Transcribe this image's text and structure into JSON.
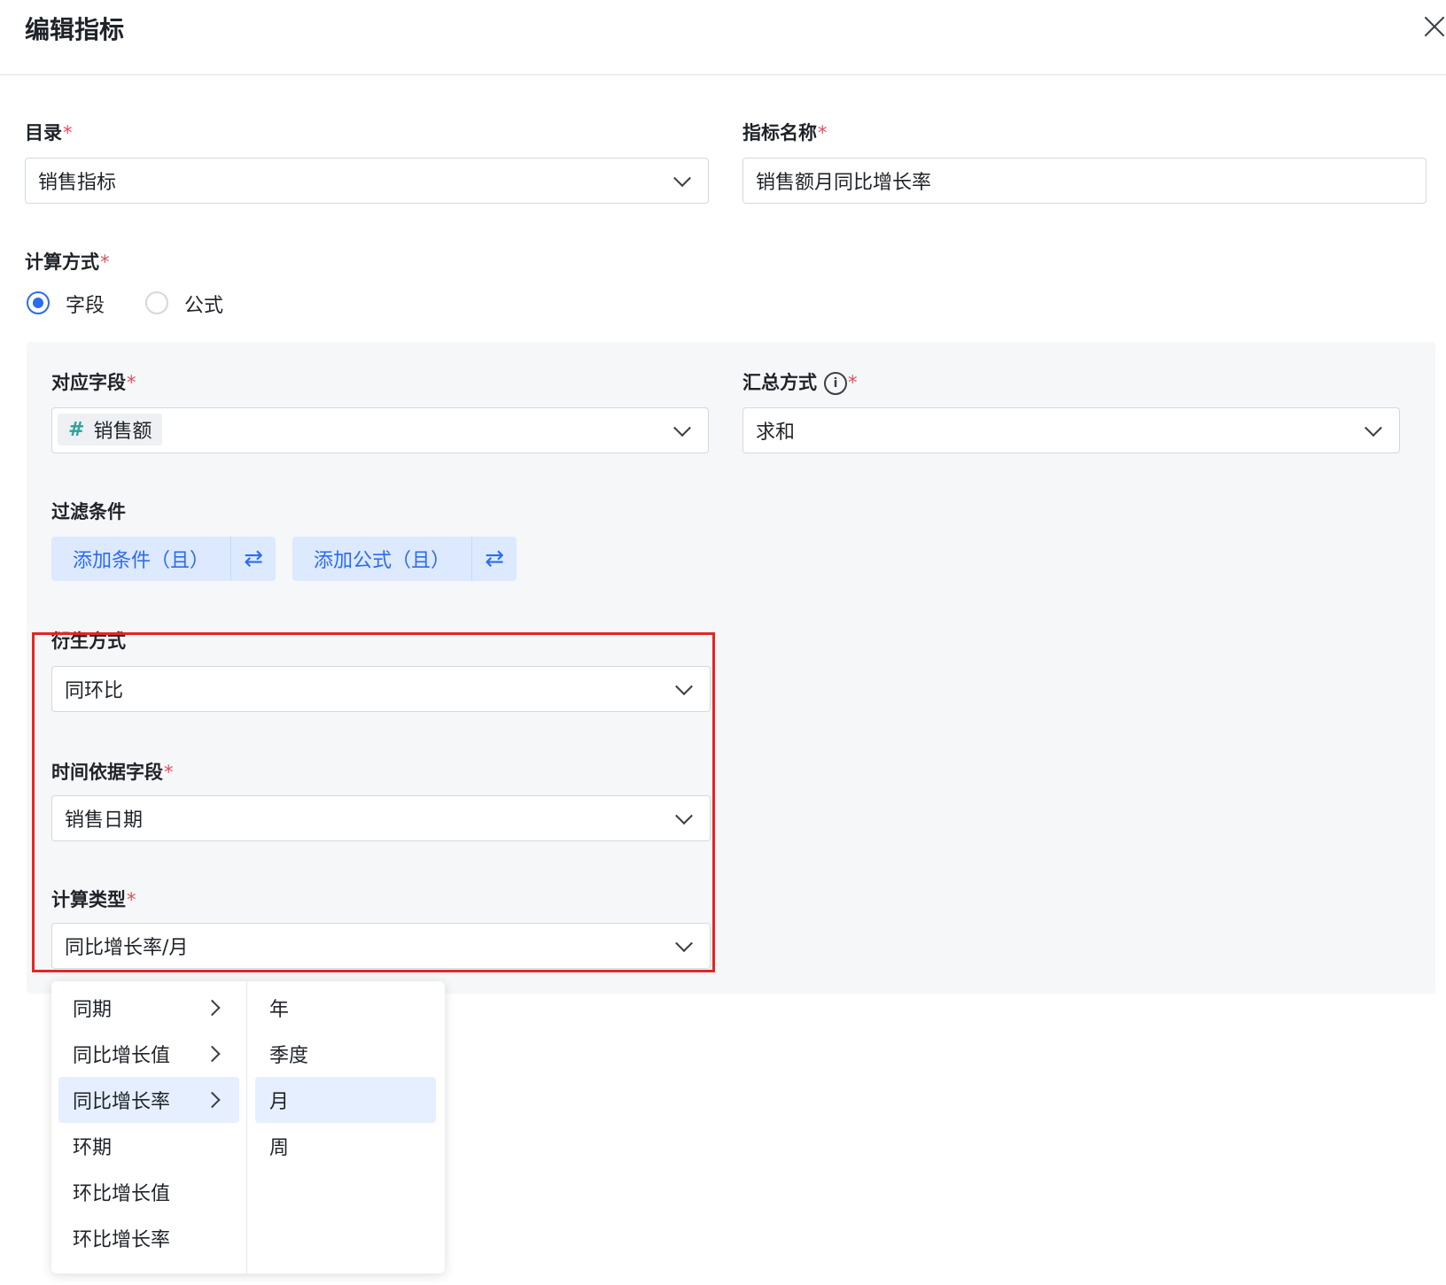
{
  "dialog": {
    "title": "编辑指标"
  },
  "catalog": {
    "label": "目录",
    "required_mark": "*",
    "value": "销售指标"
  },
  "metric_name": {
    "label": "指标名称",
    "required_mark": "*",
    "value": "销售额月同比增长率"
  },
  "calc_method": {
    "label": "计算方式",
    "required_mark": "*",
    "options": [
      {
        "label": "字段",
        "selected": true
      },
      {
        "label": "公式",
        "selected": false
      }
    ]
  },
  "field_config": {
    "field": {
      "label": "对应字段",
      "required_mark": "*",
      "tag_icon": "#",
      "value": "销售额"
    },
    "aggregation": {
      "label": "汇总方式",
      "info_icon": "i",
      "required_mark": "*",
      "value": "求和"
    },
    "filter": {
      "label": "过滤条件",
      "add_condition": "添加条件（且）",
      "add_formula": "添加公式（且）",
      "swap_icon": "⇄"
    },
    "derivation": {
      "label": "衍生方式",
      "value": "同环比"
    },
    "time_field": {
      "label": "时间依据字段",
      "required_mark": "*",
      "value": "销售日期"
    },
    "calc_type": {
      "label": "计算类型",
      "required_mark": "*",
      "value": "同比增长率/月"
    }
  },
  "cascade_menu": {
    "left": [
      {
        "label": "同期",
        "has_children": true
      },
      {
        "label": "同比增长值",
        "has_children": true
      },
      {
        "label": "同比增长率",
        "has_children": true,
        "active": true
      },
      {
        "label": "环期",
        "has_children": false
      },
      {
        "label": "环比增长值",
        "has_children": false
      },
      {
        "label": "环比增长率",
        "has_children": false
      }
    ],
    "right": [
      {
        "label": "年"
      },
      {
        "label": "季度"
      },
      {
        "label": "月",
        "active": true
      },
      {
        "label": "周"
      }
    ]
  },
  "colors": {
    "accent": "#2b6bf3",
    "highlight_border": "#e32626",
    "required": "#e34d59"
  }
}
